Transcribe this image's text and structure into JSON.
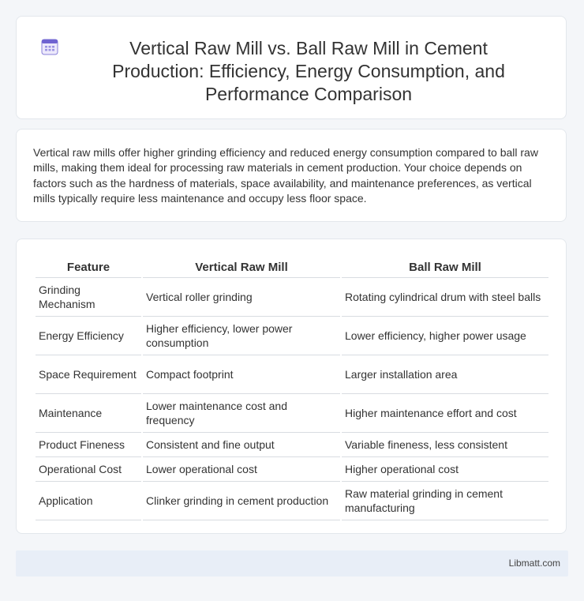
{
  "header": {
    "icon": "calendar-icon",
    "title": "Vertical Raw Mill vs. Ball Raw Mill in Cement Production: Efficiency, Energy Consumption, and Performance Comparison"
  },
  "intro": {
    "text": "Vertical raw mills offer higher grinding efficiency and reduced energy consumption compared to ball raw mills, making them ideal for processing raw materials in cement production. Your choice depends on factors such as the hardness of materials, space availability, and maintenance preferences, as vertical mills typically require less maintenance and occupy less floor space."
  },
  "table": {
    "headers": [
      "Feature",
      "Vertical Raw Mill",
      "Ball Raw Mill"
    ],
    "rows": [
      [
        "Grinding Mechanism",
        "Vertical roller grinding",
        "Rotating cylindrical drum with steel balls"
      ],
      [
        "Energy Efficiency",
        "Higher efficiency, lower power consumption",
        "Lower efficiency, higher power usage"
      ],
      [
        "Space Requirement",
        "Compact footprint",
        "Larger installation area"
      ],
      [
        "Maintenance",
        "Lower maintenance cost and frequency",
        "Higher maintenance effort and cost"
      ],
      [
        "Product Fineness",
        "Consistent and fine output",
        "Variable fineness, less consistent"
      ],
      [
        "Operational Cost",
        "Lower operational cost",
        "Higher operational cost"
      ],
      [
        "Application",
        "Clinker grinding in cement production",
        "Raw material grinding in cement manufacturing"
      ]
    ]
  },
  "footer": {
    "brand": "Libmatt.com"
  },
  "colors": {
    "icon_accent": "#7b6fd6",
    "footer_bg": "#e8eef7"
  }
}
